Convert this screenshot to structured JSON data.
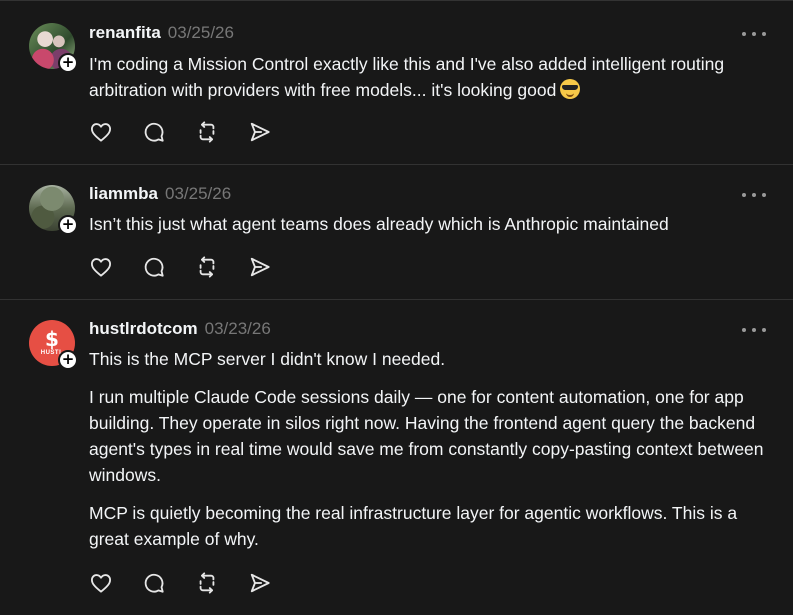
{
  "posts": [
    {
      "username": "renanfita",
      "timestamp": "03/25/26",
      "body": [
        "I'm coding a Mission Control exactly like this and I've also added intelligent routing arbitration with providers with free models... it's looking good"
      ],
      "emoji": "sunglasses-emoji"
    },
    {
      "username": "liammba",
      "timestamp": "03/25/26",
      "body": [
        "Isn’t this just what agent teams does already which is Anthropic maintained"
      ]
    },
    {
      "username": "hustlrdotcom",
      "timestamp": "03/23/26",
      "avatar_text": "$",
      "avatar_small": "HUSTL",
      "body": [
        "This is the MCP server I didn't know I needed.",
        "I run multiple Claude Code sessions daily — one for content automation, one for app building. They operate in silos right now. Having the frontend agent query the backend agent's types in real time would save me from constantly copy-pasting context between windows.",
        "MCP is quietly becoming the real infrastructure layer for agentic workflows. This is a great example of why."
      ]
    }
  ],
  "follow_badge": "+",
  "icons": [
    "heart-icon",
    "comment-icon",
    "repost-icon",
    "share-icon",
    "more-icon"
  ],
  "colors": {
    "background": "#181818",
    "text": "#f3f5f7",
    "muted": "#777777",
    "divider": "#323232",
    "avatar_hustlr": "#e64f44"
  }
}
